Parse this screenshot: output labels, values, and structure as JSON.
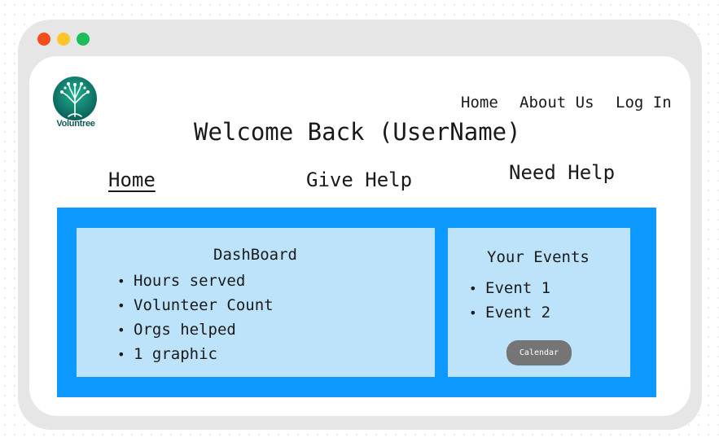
{
  "window": {
    "controls": [
      "close",
      "minimize",
      "maximize"
    ]
  },
  "brand": {
    "name": "Voluntree",
    "icon": "tree-logo-icon",
    "colors": {
      "primary": "#0e7a6f",
      "accent": "#1aa58c"
    }
  },
  "top_nav": {
    "items": [
      {
        "label": "Home"
      },
      {
        "label": "About Us"
      },
      {
        "label": "Log In"
      }
    ]
  },
  "welcome": "Welcome Back (UserName)",
  "tabs": [
    {
      "label": "Home",
      "active": true
    },
    {
      "label": "Give Help",
      "active": false
    },
    {
      "label": "Need Help",
      "active": false
    }
  ],
  "dashboard": {
    "title": "DashBoard",
    "items": [
      "Hours served",
      "Volunteer Count",
      "Orgs helped",
      "1 graphic"
    ]
  },
  "events": {
    "title": "Your Events",
    "items": [
      "Event 1",
      "Event 2"
    ],
    "button_label": "Calendar"
  },
  "colors": {
    "panel": "#0d99ff",
    "card": "#bde3fb",
    "button": "#757575"
  }
}
